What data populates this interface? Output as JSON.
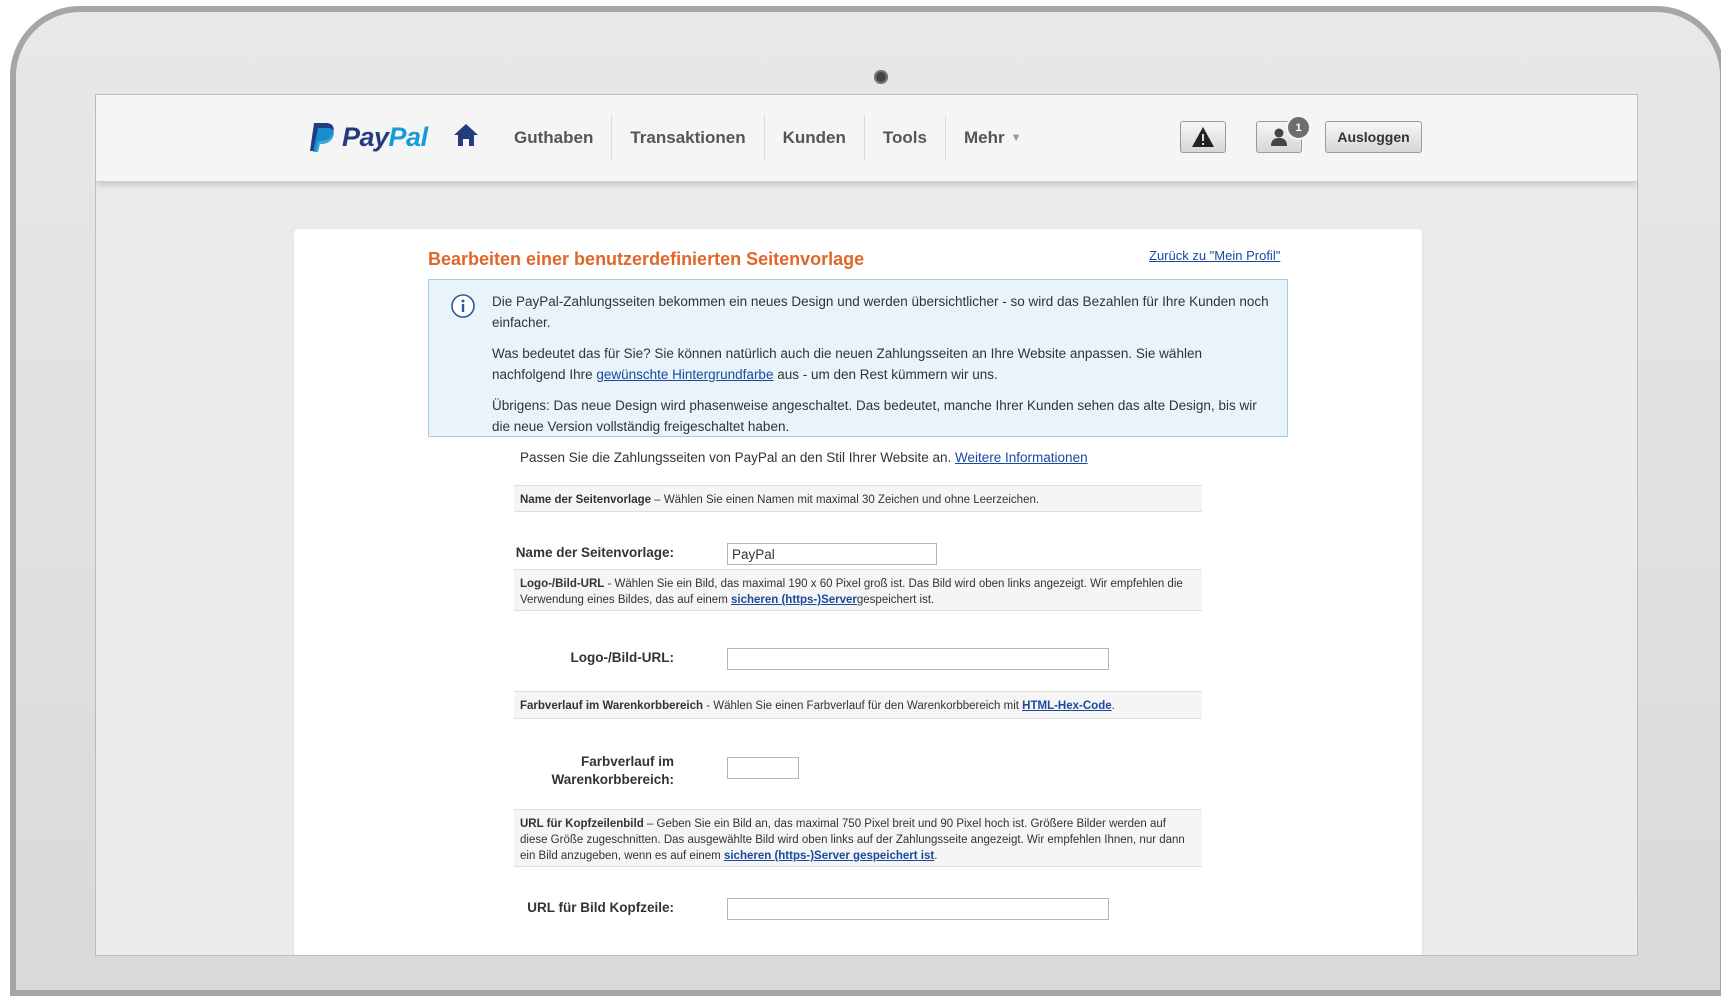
{
  "nav": {
    "brand_pay": "Pay",
    "brand_pal": "Pal",
    "items": [
      "Guthaben",
      "Transaktionen",
      "Kunden",
      "Tools",
      "Mehr"
    ],
    "more_caret": "▼",
    "notification_count": "1",
    "logout_label": "Ausloggen"
  },
  "page": {
    "title": "Bearbeiten einer benutzerdefinierten Seitenvorlage",
    "back_link": "Zurück zu \"Mein Profil\""
  },
  "info": {
    "p1": "Die PayPal-Zahlungsseiten bekommen ein neues Design und werden übersichtlicher - so wird das Bezahlen für Ihre Kunden noch einfacher.",
    "p2_before": "Was bedeutet das für Sie? Sie können natürlich auch die neuen Zahlungsseiten an Ihre Website anpassen. Sie wählen nachfolgend Ihre ",
    "p2_link": "gewünschte Hintergrundfarbe",
    "p2_after": " aus - um den Rest kümmern wir uns.",
    "p3": "Übrigens: Das neue Design wird phasenweise angeschaltet. Das bedeutet, manche Ihrer Kunden sehen das alte Design, bis wir die neue Version vollständig freigeschaltet haben."
  },
  "intro": {
    "text": "Passen Sie die Zahlungsseiten von PayPal an den Stil Ihrer Website an. ",
    "link": "Weitere Informationen"
  },
  "sections": {
    "name": {
      "bold": "Name der Seitenvorlage",
      "text": " – Wählen Sie einen Namen mit maximal 30 Zeichen und ohne Leerzeichen."
    },
    "logo": {
      "bold": "Logo-/Bild-URL",
      "text": " - Wählen Sie ein Bild, das maximal 190 x 60 Pixel groß ist. Das Bild wird oben links angezeigt. Wir empfehlen die Verwendung eines Bildes, das auf einem ",
      "link": "sicheren (https-)Server",
      "after": "gespeichert ist."
    },
    "gradient": {
      "bold": "Farbverlauf im Warenkorbbereich",
      "text": " - Wählen Sie einen Farbverlauf für den Warenkorbbereich mit ",
      "link": "HTML-Hex-Code",
      "after": "."
    },
    "header": {
      "bold": "URL für Kopfzeilenbild",
      "text": " – Geben Sie ein Bild an, das maximal 750 Pixel breit und 90 Pixel hoch ist. Größere Bilder werden auf diese Größe zugeschnitten. Das ausgewählte Bild wird oben links auf der Zahlungsseite angezeigt. Wir empfehlen Ihnen, nur dann ein Bild anzugeben, wenn es auf einem ",
      "link": "sicheren (https-)Server gespeichert ist",
      "after": "."
    }
  },
  "fields": {
    "name_label": "Name der Seitenvorlage:",
    "name_value": "PayPal",
    "logo_label": "Logo-/Bild-URL:",
    "logo_value": "",
    "gradient_label_1": "Farbverlauf im",
    "gradient_label_2": "Warenkorbbereich:",
    "gradient_value": "",
    "header_label": "URL für Bild Kopfzeile:"
  },
  "colors": {
    "brand_dark": "#253b80",
    "brand_light": "#179bd7",
    "title_orange": "#e0672a",
    "link_blue": "#1a4aa0"
  }
}
